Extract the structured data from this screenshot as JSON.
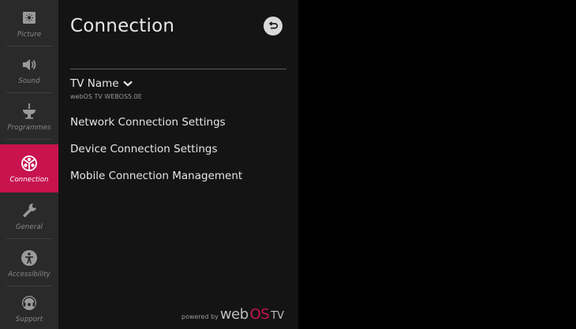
{
  "sidebar": {
    "items": [
      {
        "label": "Picture",
        "icon": "picture-icon",
        "active": false
      },
      {
        "label": "Sound",
        "icon": "speaker-icon",
        "active": false
      },
      {
        "label": "Programmes",
        "icon": "antenna-icon",
        "active": false
      },
      {
        "label": "Connection",
        "icon": "connection-icon",
        "active": true
      },
      {
        "label": "General",
        "icon": "wrench-icon",
        "active": false
      },
      {
        "label": "Accessibility",
        "icon": "accessibility-icon",
        "active": false
      },
      {
        "label": "Support",
        "icon": "support-icon",
        "active": false
      }
    ]
  },
  "header": {
    "title": "Connection",
    "back_icon": "back-arrow-icon"
  },
  "menu": {
    "tv_name": {
      "label": "TV Name",
      "value": "webOS TV WEBOS5.0E",
      "icon": "chevron-down-icon"
    },
    "network": "Network Connection Settings",
    "device": "Device Connection Settings",
    "mobile": "Mobile Connection Management"
  },
  "footer": {
    "powered_by": "powered by",
    "brand_web": "web",
    "brand_os": "OS",
    "brand_tv": "TV"
  },
  "colors": {
    "accent": "#c8134f",
    "sidebar_bg": "#2a2a2a",
    "panel_bg": "#141414"
  }
}
